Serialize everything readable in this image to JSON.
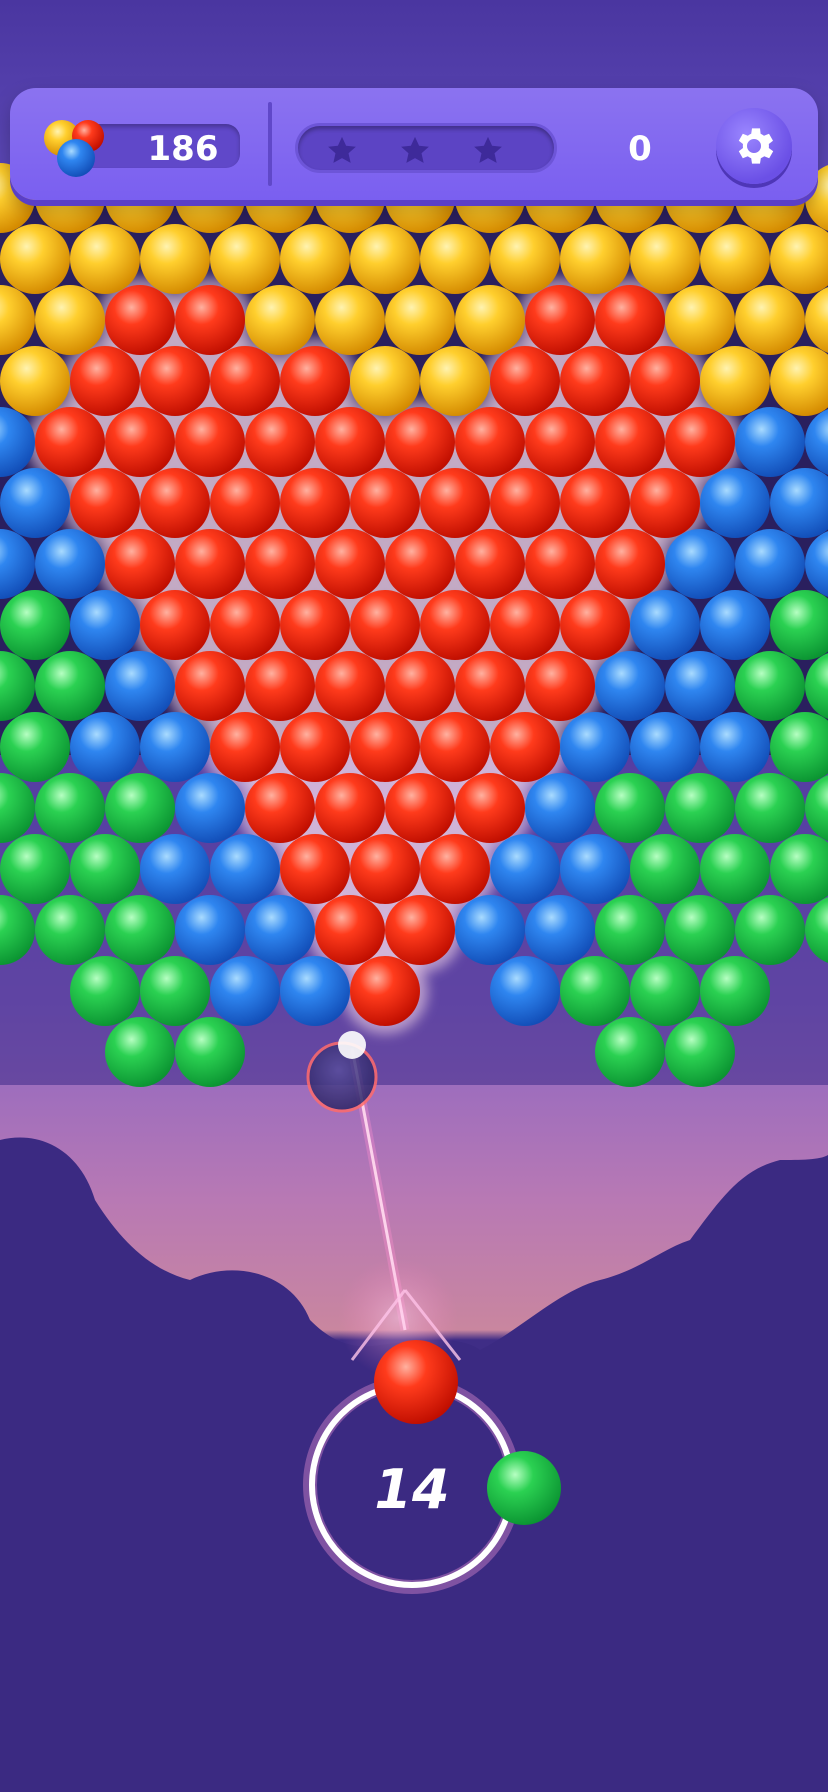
{
  "hud": {
    "coins": "186",
    "score": "0",
    "stars_total": 3,
    "stars_earned": 0,
    "settings_icon": "gear-icon",
    "coins_icon": "bubbles-cluster-icon"
  },
  "shooter": {
    "moves_left": "14",
    "loaded_bubble_color": "red",
    "next_bubble_color": "green"
  },
  "bubble_colors": {
    "yellow": "#f5b51c",
    "red": "#ee2a14",
    "blue": "#2676e0",
    "green": "#22c24a"
  }
}
